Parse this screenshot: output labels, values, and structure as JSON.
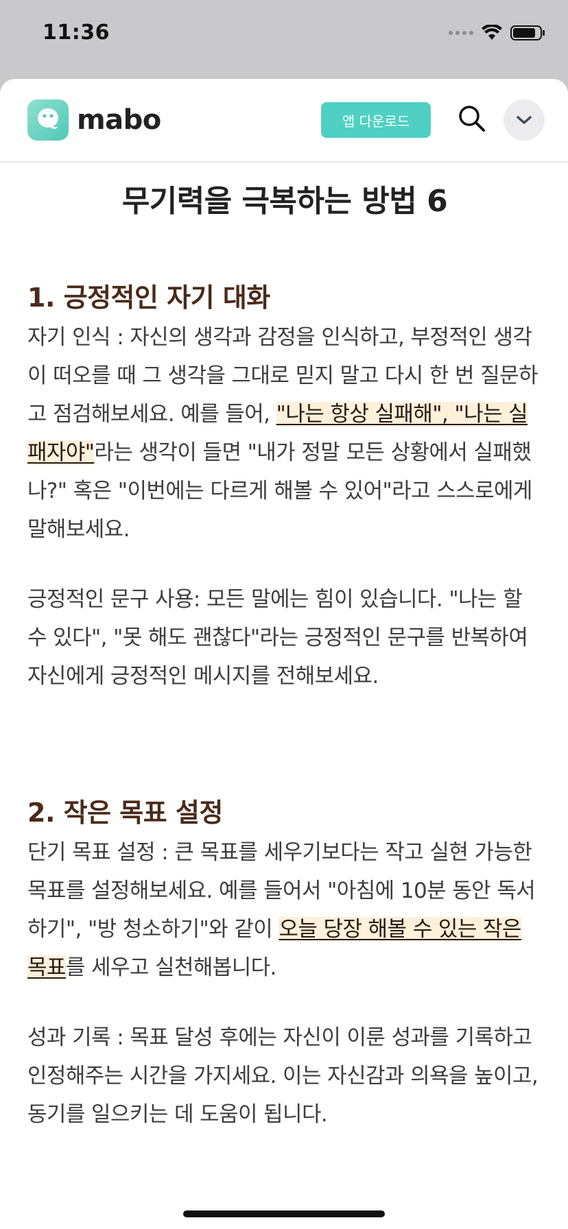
{
  "status_bar": {
    "time": "11:36"
  },
  "header": {
    "logo_text": "mabo",
    "download_label": "앱 다운로드",
    "icons": {
      "search": "search-icon",
      "menu": "chevron-down-icon"
    },
    "brand_color": "#4fd0c2"
  },
  "article": {
    "title": "무기력을 극복하는 방법 6",
    "sections": [
      {
        "heading": "1. 긍정적인 자기 대화",
        "paragraphs": [
          {
            "p1_before": "자기 인식 : 자신의 생각과 감정을 인식하고, 부정적인 생각이 떠오를 때 그 생각을 그대로 믿지 말고 다시 한 번 질문하고 점검해보세요. 예를 들어, ",
            "p1_highlight": "\"나는 항상 실패해\", \"나는 실패자야\"",
            "p1_after": "라는 생각이 들면 \"내가 정말 모든 상황에서 실패했나?\" 혹은 \"이번에는 다르게 해볼 수 있어\"라고 스스로에게 말해보세요."
          },
          {
            "text": "긍정적인 문구 사용: 모든 말에는 힘이 있습니다. \"나는 할 수 있다\", \"못 해도 괜찮다\"라는 긍정적인 문구를 반복하여 자신에게 긍정적인 메시지를 전해보세요."
          }
        ]
      },
      {
        "heading": "2. 작은 목표 설정",
        "paragraphs": [
          {
            "p1_before": "단기 목표 설정 : 큰 목표를 세우기보다는 작고 실현 가능한 목표를 설정해보세요. 예를 들어서 \"아침에 10분 동안 독서하기\", \"방 청소하기\"와 같이 ",
            "p1_highlight": "오늘 당장 해볼 수 있는 작은 목표",
            "p1_after": "를 세우고 실천해봅니다."
          },
          {
            "text": "성과 기록 : 목표 달성 후에는 자신이 이룬 성과를 기록하고 인정해주는 시간을 가지세요. 이는 자신감과 의욕을 높이고, 동기를 일으키는 데 도움이 됩니다."
          }
        ]
      }
    ]
  }
}
